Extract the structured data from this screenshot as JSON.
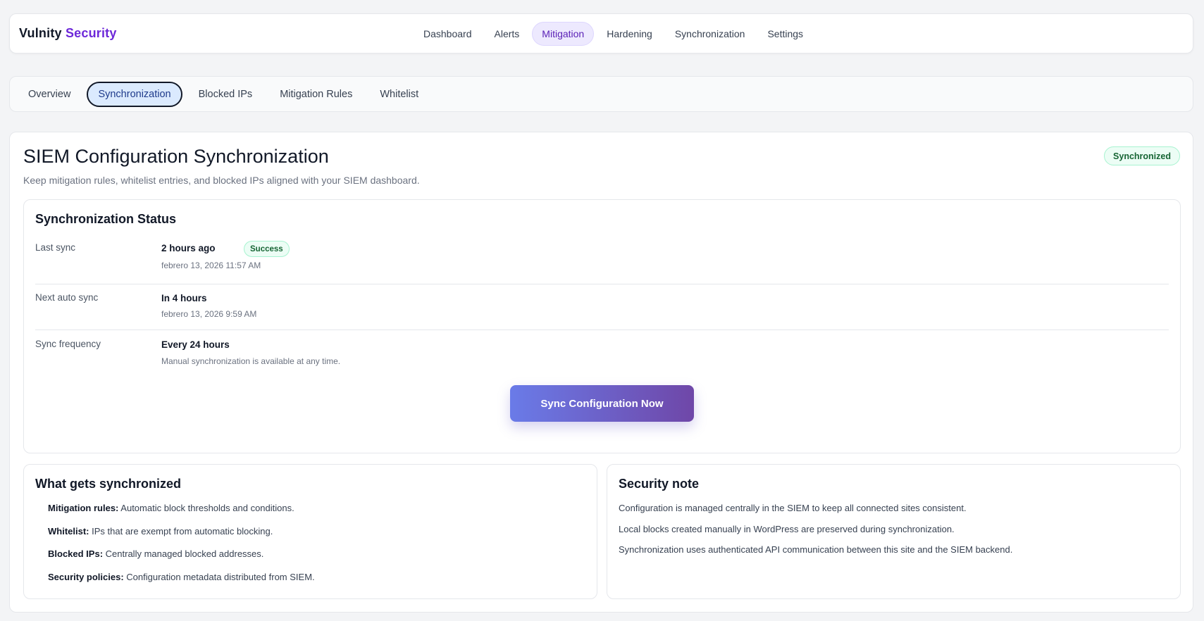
{
  "brand": {
    "name": "Vulnity",
    "accent": "Security"
  },
  "nav": {
    "items": [
      {
        "label": "Dashboard",
        "active": false
      },
      {
        "label": "Alerts",
        "active": false
      },
      {
        "label": "Mitigation",
        "active": true
      },
      {
        "label": "Hardening",
        "active": false
      },
      {
        "label": "Synchronization",
        "active": false
      },
      {
        "label": "Settings",
        "active": false
      }
    ]
  },
  "tabs": {
    "items": [
      {
        "label": "Overview",
        "active": false
      },
      {
        "label": "Synchronization",
        "active": true
      },
      {
        "label": "Blocked IPs",
        "active": false
      },
      {
        "label": "Mitigation Rules",
        "active": false
      },
      {
        "label": "Whitelist",
        "active": false
      }
    ]
  },
  "page": {
    "title": "SIEM Configuration Synchronization",
    "subtitle": "Keep mitigation rules, whitelist entries, and blocked IPs aligned with your SIEM dashboard.",
    "badge": "Synchronized"
  },
  "status": {
    "title": "Synchronization Status",
    "last_sync": {
      "label": "Last sync",
      "value": "2 hours ago",
      "badge": "Success",
      "meta": "febrero 13, 2026 11:57 AM"
    },
    "next_sync": {
      "label": "Next auto sync",
      "value": "In 4 hours",
      "meta": "febrero 13, 2026 9:59 AM"
    },
    "frequency": {
      "label": "Sync frequency",
      "value": "Every 24 hours",
      "meta": "Manual synchronization is available at any time."
    },
    "button": "Sync Configuration Now"
  },
  "what": {
    "title": "What gets synchronized",
    "items": [
      {
        "term": "Mitigation rules:",
        "desc": "Automatic block thresholds and conditions."
      },
      {
        "term": "Whitelist:",
        "desc": "IPs that are exempt from automatic blocking."
      },
      {
        "term": "Blocked IPs:",
        "desc": "Centrally managed blocked addresses."
      },
      {
        "term": "Security policies:",
        "desc": "Configuration metadata distributed from SIEM."
      }
    ]
  },
  "note": {
    "title": "Security note",
    "lines": [
      "Configuration is managed centrally in the SIEM to keep all connected sites consistent.",
      "Local blocks created manually in WordPress are preserved during synchronization.",
      "Synchronization uses authenticated API communication between this site and the SIEM backend."
    ]
  },
  "colors": {
    "brand_accent": "#6d28d9",
    "success": "#166534",
    "button_start": "#6a7be8",
    "button_end": "#6f47a8"
  }
}
